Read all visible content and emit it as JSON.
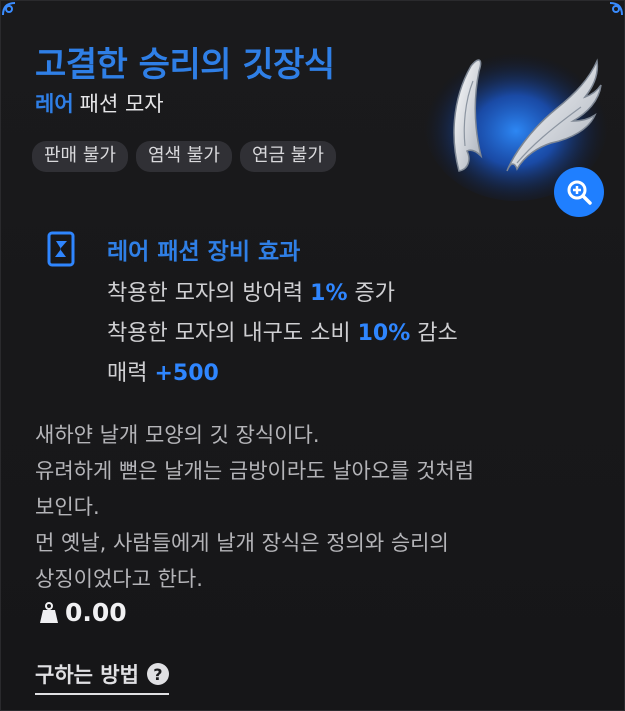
{
  "item": {
    "name": "고결한 승리의 깃장식",
    "rarity": "레어",
    "category": "패션 모자"
  },
  "tags": [
    "판매 불가",
    "염색 불가",
    "연금 불가"
  ],
  "effect": {
    "title": "레어 패션 장비 효과",
    "lines": [
      {
        "before": "착용한 모자의 방어력 ",
        "value": "1%",
        "after": " 증가"
      },
      {
        "before": "착용한 모자의 내구도 소비 ",
        "value": "10%",
        "after": " 감소"
      },
      {
        "before": "매력 ",
        "value": "+500",
        "after": ""
      }
    ]
  },
  "description": [
    "새하얀 날개 모양의 깃 장식이다.",
    "유려하게 뻗은 날개는 금방이라도 날아오를 것처럼",
    "보인다.",
    "먼 옛날, 사람들에게 날개 장식은 정의와 승리의",
    "상징이었다고 한다."
  ],
  "weight": "0.00",
  "how_to_obtain": "구하는 방법",
  "icons": {
    "zoom": "zoom-in-icon",
    "effect": "fashion-effect-icon",
    "weight": "weight-icon",
    "help": "question-icon"
  },
  "colors": {
    "accent": "#2f7fe6",
    "highlight": "#2f86ff",
    "zoom_button": "#1f7fff",
    "background": "#1a1a1c"
  }
}
